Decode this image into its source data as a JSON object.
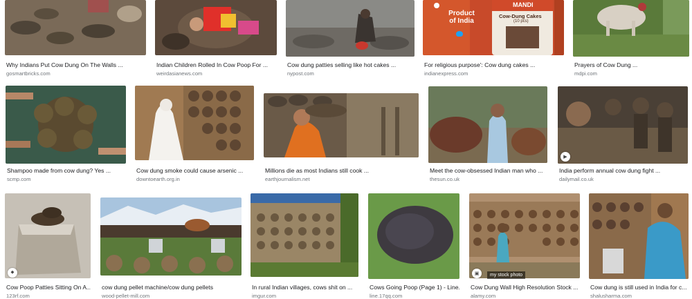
{
  "results": [
    {
      "title": "Why Indians Put Cow Dung On The Walls ...",
      "source": "gosmartbricks.com"
    },
    {
      "title": "Indian Children Rolled In Cow Poop For ...",
      "source": "weirdasianews.com"
    },
    {
      "title": "Cow dung patties selling like hot cakes ...",
      "source": "nypost.com"
    },
    {
      "title": "For religious purpose': Cow dung cakes ...",
      "source": "indianexpress.com",
      "image_text": {
        "product": "Product of India",
        "jar_brand": "MANDI",
        "jar_label": "Cow-Dung Cakes",
        "jar_count": "(10 pcs)"
      }
    },
    {
      "title": "Prayers of Cow Dung ...",
      "source": "mdpi.com"
    },
    {
      "title": "Shampoo made from cow dung? Yes ...",
      "source": "scmp.com"
    },
    {
      "title": "Cow dung smoke could cause arsenic ...",
      "source": "downtoearth.org.in"
    },
    {
      "title": "Millions die as most Indians still cook ...",
      "source": "earthjournalism.net"
    },
    {
      "title": "Meet the cow-obsessed Indian man who ...",
      "source": "thesun.co.uk"
    },
    {
      "title": "India perform annual cow dung fight ...",
      "source": "dailymail.co.uk"
    },
    {
      "title": "Cow Poop Patties Sitting On A...",
      "source": "123rf.com"
    },
    {
      "title": "cow dung pellet machine/cow dung pellets",
      "source": "wood-pellet-mill.com"
    },
    {
      "title": "In rural Indian villages, cows shit on ...",
      "source": "imgur.com"
    },
    {
      "title": "Cows Going Poop (Page 1) - Line...",
      "source": "line.17qq.com"
    },
    {
      "title": "Cow Dung Wall High Resolution Stock ...",
      "source": "alamy.com",
      "image_text": {
        "watermark": "my stock photo"
      }
    },
    {
      "title": "Cow dung is still used in India for c...",
      "source": "shalusharma.com"
    }
  ]
}
